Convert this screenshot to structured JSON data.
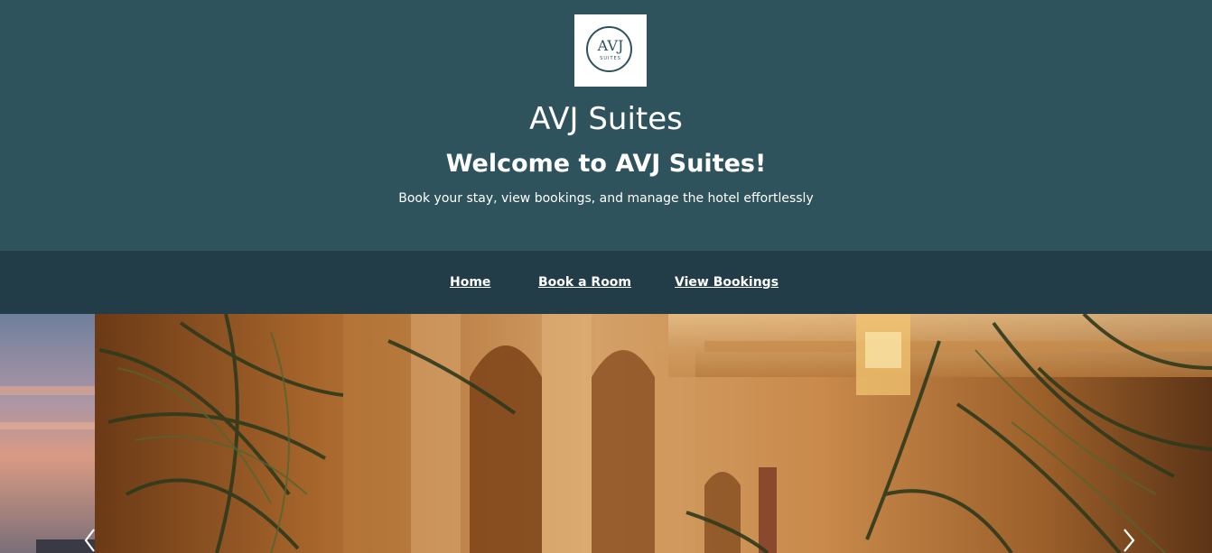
{
  "header": {
    "logo": {
      "main_text": "AVJ",
      "sub_text": "SUITES"
    },
    "title": "AVJ Suites",
    "welcome": "Welcome to AVJ Suites!",
    "tagline": "Book your stay, view bookings, and manage the hotel effortlessly"
  },
  "nav": {
    "items": [
      {
        "label": "Home"
      },
      {
        "label": "Book a Room"
      },
      {
        "label": "View Bookings"
      }
    ]
  },
  "carousel": {
    "prev_icon": "chevron-left-icon",
    "next_icon": "chevron-right-icon"
  },
  "colors": {
    "header_bg": "#2e535c",
    "nav_bg": "#233d48",
    "text": "#ffffff"
  }
}
